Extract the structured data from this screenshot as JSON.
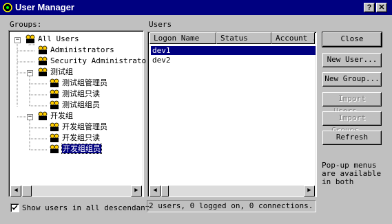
{
  "window": {
    "title": "User Manager",
    "help_label": "?",
    "close_label": "✕"
  },
  "groups_label": "Groups:",
  "users_label": "Users",
  "tree": {
    "all_users": "All Users",
    "administrators": "Administrators",
    "security_administrators": "Security Administrator",
    "test_group": "测试组",
    "test_admin": "测试组管理员",
    "test_readonly": "测试组只读",
    "test_members": "测试组组员",
    "dev_group": "开发组",
    "dev_admin": "开发组管理员",
    "dev_readonly": "开发组只读",
    "dev_members": "开发组组员",
    "expanded_symbol": "−"
  },
  "users_table": {
    "columns": [
      "Logon Name",
      "Status",
      "Account ..."
    ],
    "rows": [
      "dev1",
      "dev2"
    ]
  },
  "buttons": {
    "close": "Close",
    "new_user": "New User...",
    "new_group": "New Group...",
    "import_users": "Import Users...",
    "import_groups": "Import Groups...",
    "refresh": "Refresh"
  },
  "hint_text": [
    "Pop-up menus",
    "are available",
    "in both"
  ],
  "show_users_checkbox": {
    "label": "Show users in all descendant",
    "checked": true
  },
  "status_text": "2 users, 0 logged on, 0 connections."
}
